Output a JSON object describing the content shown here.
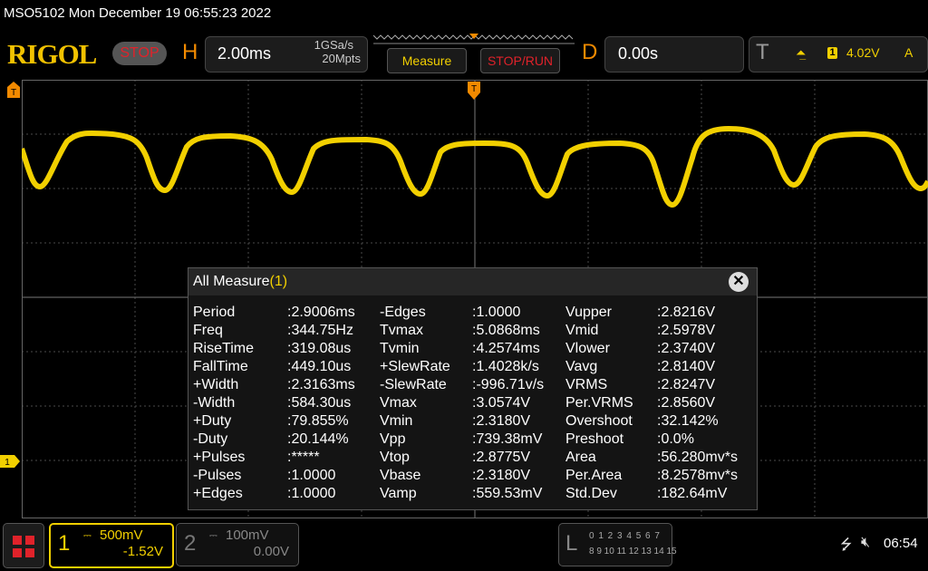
{
  "status_line": "MSO5102  Mon December 19 06:55:23 2022",
  "header": {
    "logo": "RIGOL",
    "run_state": "STOP",
    "horizontal": {
      "letter": "H",
      "timebase": "2.00ms",
      "sample_rate": "1GSa/s",
      "memory_depth": "20Mpts"
    },
    "measure_button": "Measure",
    "stop_run_button": "STOP/RUN",
    "delay": {
      "letter": "D",
      "value": "0.00s"
    },
    "trigger": {
      "letter": "T",
      "source": "1",
      "level": "4.02V",
      "coupling": "A"
    }
  },
  "markers": {
    "channel1": "1"
  },
  "measure_panel": {
    "title": "All Measure",
    "title_index": "(1)",
    "close_glyph": "✕",
    "columns": [
      [
        {
          "name": "Period",
          "value": ":2.9006ms"
        },
        {
          "name": "Freq",
          "value": ":344.75Hz"
        },
        {
          "name": "RiseTime",
          "value": ":319.08us"
        },
        {
          "name": "FallTime",
          "value": ":449.10us"
        },
        {
          "name": "+Width",
          "value": ":2.3163ms"
        },
        {
          "name": "-Width",
          "value": ":584.30us"
        },
        {
          "name": "+Duty",
          "value": ":79.855%"
        },
        {
          "name": "-Duty",
          "value": ":20.144%"
        },
        {
          "name": "+Pulses",
          "value": ":*****"
        },
        {
          "name": "-Pulses",
          "value": ":1.0000"
        },
        {
          "name": "+Edges",
          "value": ":1.0000"
        }
      ],
      [
        {
          "name": "-Edges",
          "value": ":1.0000"
        },
        {
          "name": "Tvmax",
          "value": ":5.0868ms"
        },
        {
          "name": "Tvmin",
          "value": ":4.2574ms"
        },
        {
          "name": "+SlewRate",
          "value": ":1.4028k/s"
        },
        {
          "name": "-SlewRate",
          "value": ":-996.71v/s"
        },
        {
          "name": "Vmax",
          "value": ":3.0574V"
        },
        {
          "name": "Vmin",
          "value": ":2.3180V"
        },
        {
          "name": "Vpp",
          "value": ":739.38mV"
        },
        {
          "name": "Vtop",
          "value": ":2.8775V"
        },
        {
          "name": "Vbase",
          "value": ":2.3180V"
        },
        {
          "name": "Vamp",
          "value": ":559.53mV"
        }
      ],
      [
        {
          "name": "Vupper",
          "value": ":2.8216V"
        },
        {
          "name": "Vmid",
          "value": ":2.5978V"
        },
        {
          "name": "Vlower",
          "value": ":2.3740V"
        },
        {
          "name": "Vavg",
          "value": ":2.8140V"
        },
        {
          "name": "VRMS",
          "value": ":2.8247V"
        },
        {
          "name": "Per.VRMS",
          "value": ":2.8560V"
        },
        {
          "name": "Overshoot",
          "value": ":32.142%"
        },
        {
          "name": "Preshoot",
          "value": ":0.0%"
        },
        {
          "name": "Area",
          "value": ":56.280mv*s"
        },
        {
          "name": "Per.Area",
          "value": ":8.2578mv*s"
        },
        {
          "name": "Std.Dev",
          "value": ":182.64mV"
        }
      ]
    ]
  },
  "channels": [
    {
      "number": "1",
      "scale": "500mV",
      "offset": "-1.52V",
      "active": true,
      "color": "#f2d000"
    },
    {
      "number": "2",
      "scale": "100mV",
      "offset": "0.00V",
      "active": false,
      "color": "#888888"
    }
  ],
  "logic_analyzer": {
    "letter": "L",
    "row1": "0 1 2 3  4 5 6 7",
    "row2": "8 9 10 11 12 13 14 15"
  },
  "system": {
    "clock": "06:54"
  },
  "icons": {
    "menu": "grid-menu-icon",
    "usb": "usb-icon",
    "speaker": "speaker-muted-icon",
    "trigger_edge": "rising-edge-icon",
    "coupling": "dc-coupling-icon"
  },
  "colors": {
    "ch1": "#f2d000",
    "accent_orange": "#f28a00",
    "stop_red": "#e0222a",
    "grid": "#4a4a4a"
  }
}
